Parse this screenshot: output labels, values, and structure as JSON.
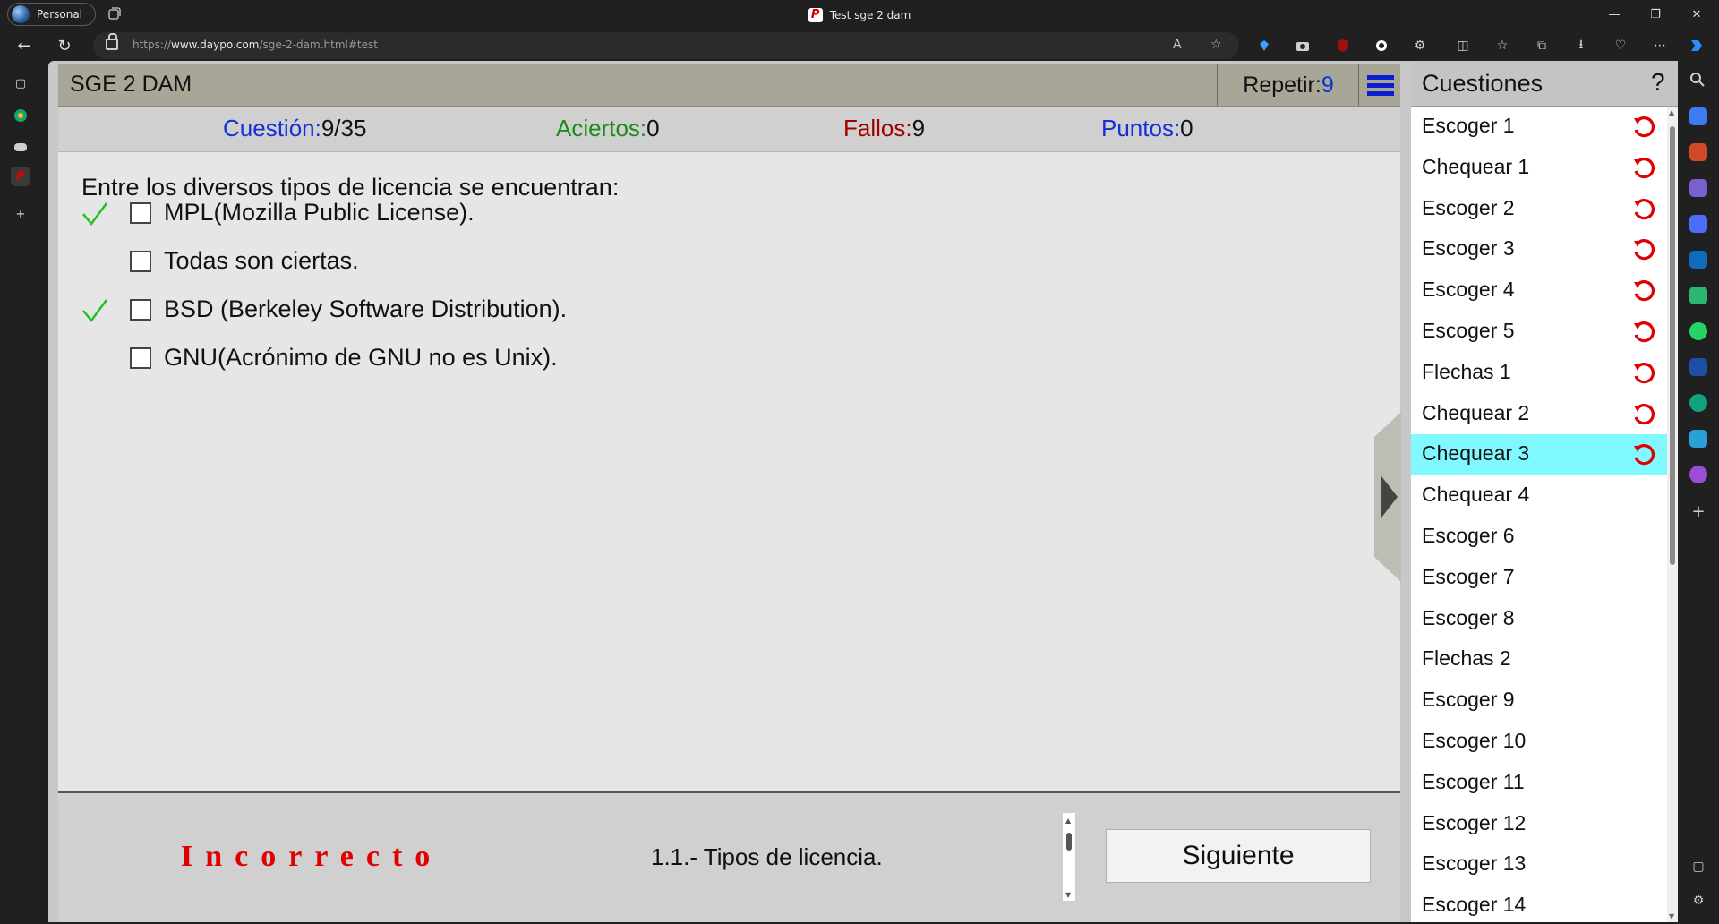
{
  "browser": {
    "profile_label": "Personal",
    "tab_title": "Test sge 2 dam",
    "url_prefix": "https://",
    "url_host": "www.daypo.com",
    "url_path": "/sge-2-dam.html#test"
  },
  "header": {
    "title": "SGE 2 DAM",
    "repetir_label": "Repetir:",
    "repetir_value": "9"
  },
  "stats": {
    "cuestion_label": "Cuestión:",
    "cuestion_value": "9/35",
    "aciertos_label": "Aciertos:",
    "aciertos_value": "0",
    "fallos_label": "Fallos:",
    "fallos_value": "9",
    "puntos_label": "Puntos:",
    "puntos_value": "0",
    "colors": {
      "cuestion": "#1530d8",
      "aciertos": "#1c8c1c",
      "fallos": "#a00000",
      "puntos": "#1530d8"
    }
  },
  "question": {
    "text": "Entre los diversos tipos de licencia se encuentran:",
    "options": [
      {
        "text": "MPL(Mozilla Public License).",
        "correct_mark": true,
        "checked": false
      },
      {
        "text": "Todas son ciertas.",
        "correct_mark": false,
        "checked": false
      },
      {
        "text": "BSD (Berkeley Software Distribution).",
        "correct_mark": true,
        "checked": false
      },
      {
        "text": "GNU(Acrónimo de GNU no es Unix).",
        "correct_mark": false,
        "checked": false
      }
    ]
  },
  "footer": {
    "result": "Incorrecto",
    "topic": "1.1.- Tipos de licencia.",
    "next_label": "Siguiente"
  },
  "panel": {
    "title": "Cuestiones",
    "help": "?",
    "items": [
      {
        "label": "Escoger 1",
        "retry": true,
        "active": false
      },
      {
        "label": "Chequear 1",
        "retry": true,
        "active": false
      },
      {
        "label": "Escoger 2",
        "retry": true,
        "active": false
      },
      {
        "label": "Escoger 3",
        "retry": true,
        "active": false
      },
      {
        "label": "Escoger 4",
        "retry": true,
        "active": false
      },
      {
        "label": "Escoger 5",
        "retry": true,
        "active": false
      },
      {
        "label": "Flechas 1",
        "retry": true,
        "active": false
      },
      {
        "label": "Chequear 2",
        "retry": true,
        "active": false
      },
      {
        "label": "Chequear 3",
        "retry": true,
        "active": true
      },
      {
        "label": "Chequear 4",
        "retry": false,
        "active": false
      },
      {
        "label": "Escoger 6",
        "retry": false,
        "active": false
      },
      {
        "label": "Escoger 7",
        "retry": false,
        "active": false
      },
      {
        "label": "Escoger 8",
        "retry": false,
        "active": false
      },
      {
        "label": "Flechas 2",
        "retry": false,
        "active": false
      },
      {
        "label": "Escoger 9",
        "retry": false,
        "active": false
      },
      {
        "label": "Escoger 10",
        "retry": false,
        "active": false
      },
      {
        "label": "Escoger 11",
        "retry": false,
        "active": false
      },
      {
        "label": "Escoger 12",
        "retry": false,
        "active": false
      },
      {
        "label": "Escoger 13",
        "retry": false,
        "active": false
      },
      {
        "label": "Escoger 14",
        "retry": false,
        "active": false
      }
    ]
  },
  "colors": {
    "header_bg": "#a8a697",
    "active_item": "#7ff9ff",
    "result_text": "#e00000",
    "check_mark": "#22c122",
    "retry_icon": "#e00000",
    "menu_icon": "#0b1fd0"
  }
}
